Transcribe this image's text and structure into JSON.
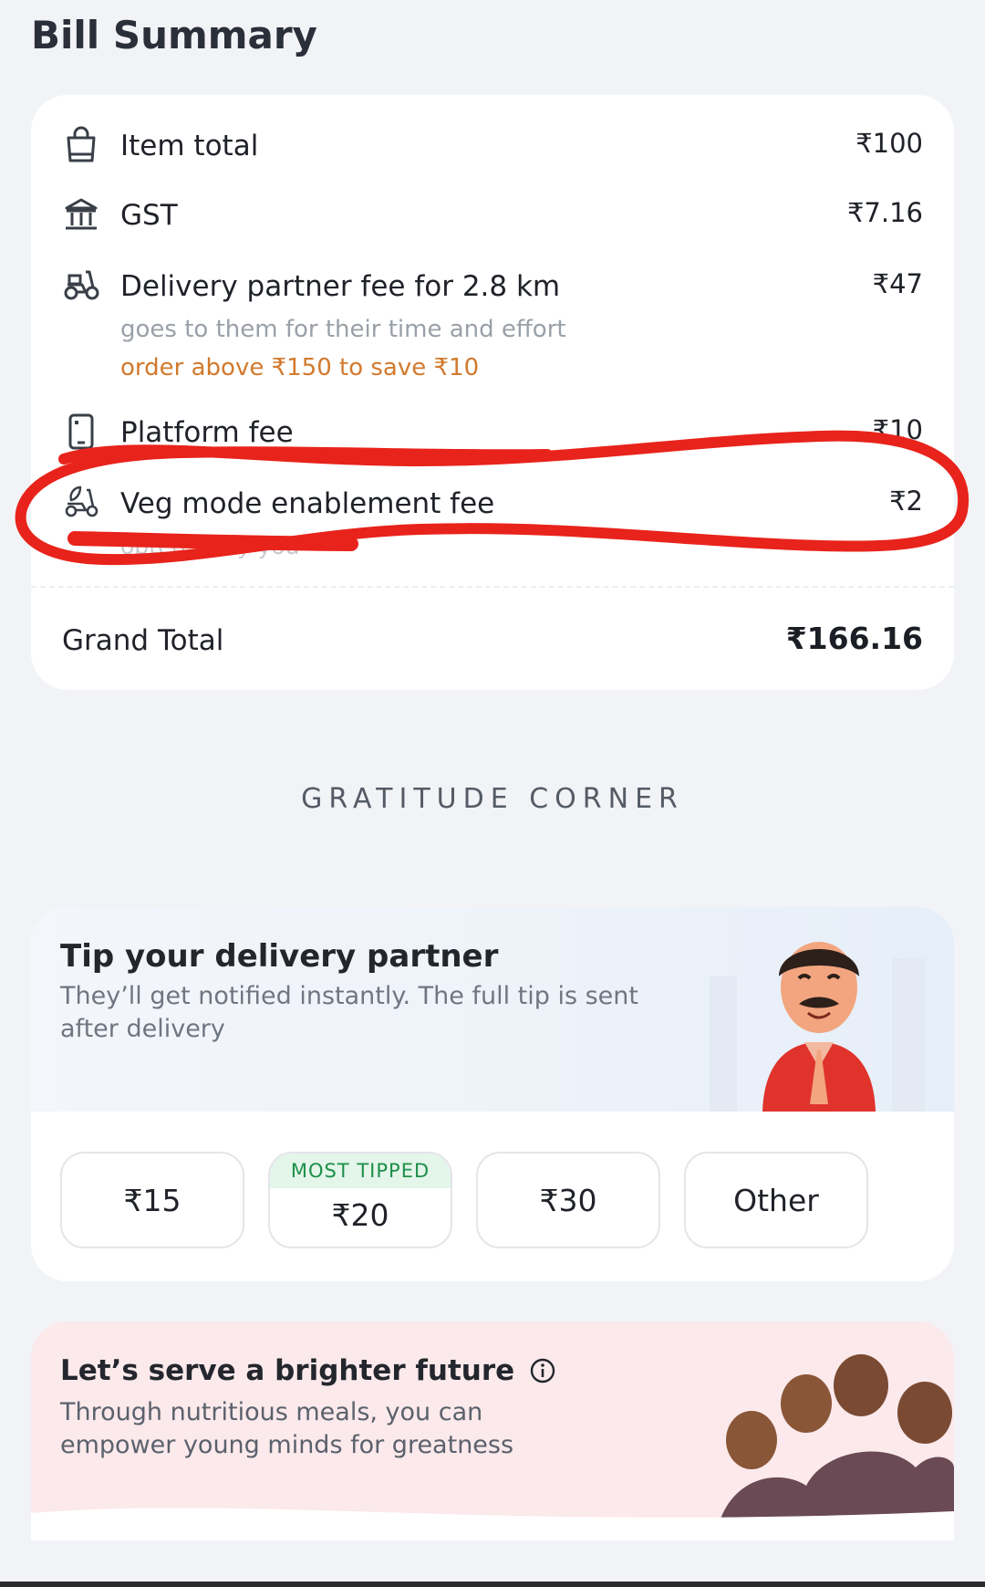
{
  "header": {
    "title": "Bill Summary"
  },
  "bill": {
    "items": [
      {
        "label": "Item total",
        "amount": "₹100",
        "icon": "shopping-bag-icon"
      },
      {
        "label": "GST",
        "amount": "₹7.16",
        "icon": "bank-icon"
      },
      {
        "label": "Delivery partner fee for 2.8 km",
        "amount": "₹47",
        "icon": "scooter-icon",
        "sub": "goes to them for their time and effort",
        "note": "order above ₹150 to save ₹10"
      },
      {
        "label": "Platform fee",
        "amount": "₹10",
        "icon": "phone-icon"
      },
      {
        "label": "Veg mode enablement fee",
        "amount": "₹2",
        "icon": "leaf-scooter-icon",
        "sub": "opted-in by you"
      }
    ],
    "grand_total_label": "Grand Total",
    "grand_total": "₹166.16"
  },
  "annotation": {
    "color": "#e8231b"
  },
  "gratitude": {
    "heading": "GRATITUDE CORNER",
    "tip": {
      "title": "Tip your delivery partner",
      "subtitle": "They’ll get notified instantly. The full tip is sent after delivery",
      "options": [
        "₹15",
        "₹20",
        "₹30",
        "Other"
      ],
      "most_tipped_tag": "MOST TIPPED"
    }
  },
  "future": {
    "title": "Let’s serve a brighter future",
    "subtitle": "Through nutritious meals, you can empower young minds for greatness",
    "info_icon": "info-icon"
  }
}
